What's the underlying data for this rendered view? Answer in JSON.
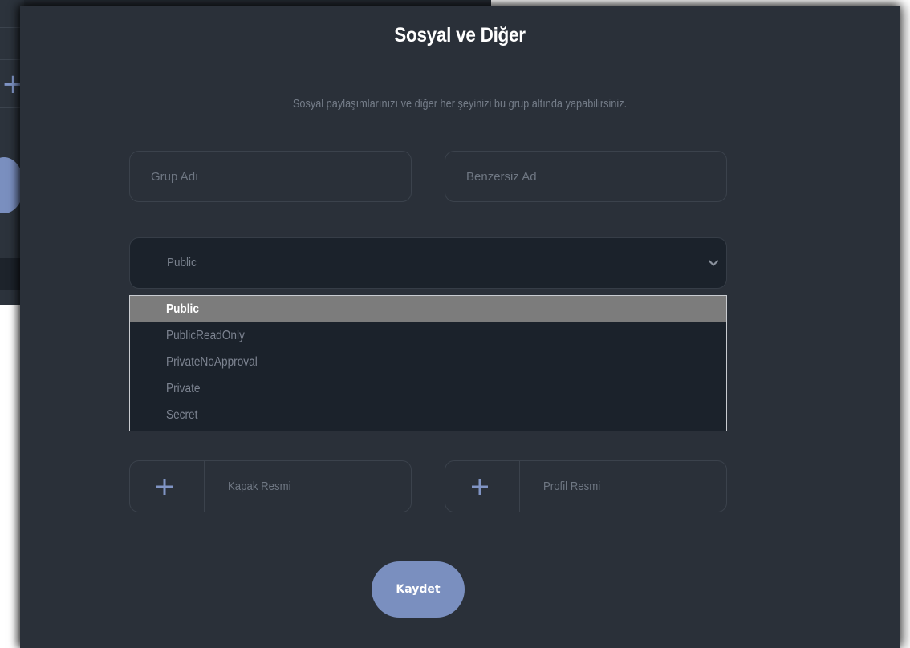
{
  "modal": {
    "title": "Sosyal ve Diğer",
    "subtitle": "Sosyal paylaşımlarınızı ve diğer her şeyinizi bu grup altında yapabilirsiniz."
  },
  "form": {
    "group_name_placeholder": "Grup Adı",
    "unique_name_placeholder": "Benzersiz Ad",
    "privacy_select": {
      "value": "Public",
      "options": [
        "Public",
        "PublicReadOnly",
        "PrivateNoApproval",
        "Private",
        "Secret"
      ],
      "highlighted_index": 0
    },
    "cover_image_label": "Kapak Resmi",
    "profile_image_label": "Profil Resmi",
    "save_label": "Kaydet"
  },
  "icons": {
    "plus": "plus-icon",
    "chevron": "chevron-down-icon"
  },
  "colors": {
    "modal_bg": "#2a3039",
    "select_bg": "#1b222b",
    "accent": "#7a8fbf",
    "highlight": "#7c7c7c",
    "muted_text": "#747c88"
  }
}
